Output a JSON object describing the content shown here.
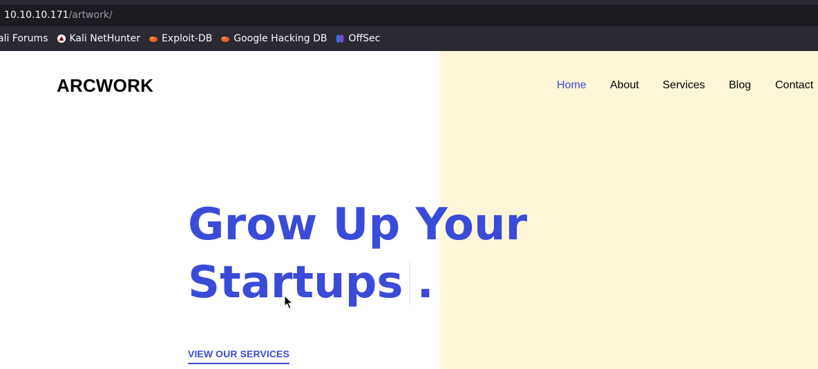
{
  "browser": {
    "url_host": "10.10.10.171",
    "url_path": "/artwork/",
    "bookmarks": [
      {
        "label": "ali Forums",
        "icon": "kali-dragon-icon"
      },
      {
        "label": "Kali NetHunter",
        "icon": "nethunter-icon"
      },
      {
        "label": "Exploit-DB",
        "icon": "exploit-db-icon"
      },
      {
        "label": "Google Hacking DB",
        "icon": "exploit-db-icon"
      },
      {
        "label": "OffSec",
        "icon": "offsec-icon"
      }
    ]
  },
  "site": {
    "logo": "ARCWORK",
    "nav": [
      {
        "label": "Home",
        "active": true
      },
      {
        "label": "About",
        "active": false
      },
      {
        "label": "Services",
        "active": false
      },
      {
        "label": "Blog",
        "active": false
      },
      {
        "label": "Contact",
        "active": false
      }
    ],
    "hero_line1": "Grow Up Your",
    "hero_line2": "Startups",
    "hero_period": ".",
    "cta_label": "VIEW OUR SERVICES"
  },
  "colors": {
    "accent": "#3a4bd8",
    "beige_panel": "#fff5d9",
    "browser_bg": "#1c1b22",
    "bookmarks_bg": "#2b2a33"
  }
}
